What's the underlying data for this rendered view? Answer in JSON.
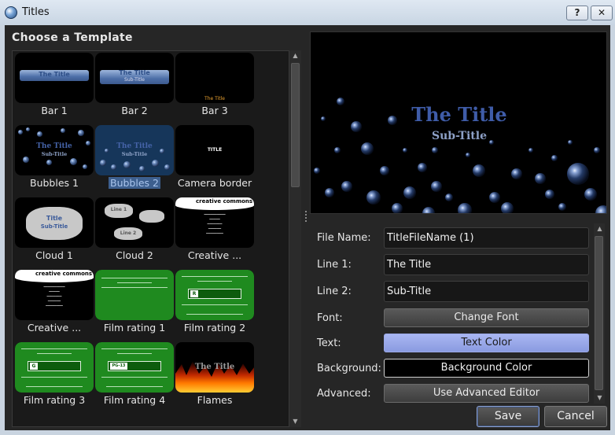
{
  "window": {
    "title": "Titles",
    "help_glyph": "?",
    "close_glyph": "✕"
  },
  "left_panel": {
    "heading": "Choose a Template"
  },
  "templates": [
    {
      "label": "Bar 1",
      "thumb_text": "The Title"
    },
    {
      "label": "Bar 2",
      "thumb_text": "The Title",
      "thumb_sub": "Sub-Title"
    },
    {
      "label": "Bar 3",
      "thumb_text": "The Title"
    },
    {
      "label": "Bubbles 1",
      "thumb_text": "The Title",
      "thumb_sub": "Sub-Title"
    },
    {
      "label": "Bubbles 2",
      "thumb_text": "The Title",
      "thumb_sub": "Sub-Title",
      "selected": true
    },
    {
      "label": "Camera border",
      "thumb_text": "TITLE"
    },
    {
      "label": "Cloud 1",
      "thumb_text": "Title",
      "thumb_sub": "Sub-Title"
    },
    {
      "label": "Cloud 2",
      "thumb_text": "Line 1",
      "thumb_sub": "Line 2"
    },
    {
      "label": "Creative ...",
      "logo_text": "creative commons"
    },
    {
      "label": "Creative ...",
      "logo_text": "creative commons"
    },
    {
      "label": "Film rating 1",
      "rating_text": "R"
    },
    {
      "label": "Film rating 2",
      "rating_text": "R"
    },
    {
      "label": "Film rating 3",
      "rating_text": "G"
    },
    {
      "label": "Film rating 4",
      "rating_text": "PG-13"
    },
    {
      "label": "Flames",
      "thumb_text": "The Title"
    }
  ],
  "preview": {
    "title": "The Title",
    "subtitle": "Sub-Title"
  },
  "form": {
    "file_name_label": "File Name:",
    "file_name_value": "TitleFileName (1)",
    "line1_label": "Line 1:",
    "line1_value": "The Title",
    "line2_label": "Line 2:",
    "line2_value": "Sub-Title",
    "font_label": "Font:",
    "font_button": "Change Font",
    "text_label": "Text:",
    "text_button": "Text Color",
    "background_label": "Background:",
    "background_button": "Background Color",
    "advanced_label": "Advanced:",
    "advanced_button": "Use Advanced Editor"
  },
  "buttons": {
    "save": "Save",
    "cancel": "Cancel"
  },
  "colors": {
    "text_color": "#8a9be0",
    "background_color": "#000000",
    "title_blue": "#3f5ca8"
  }
}
